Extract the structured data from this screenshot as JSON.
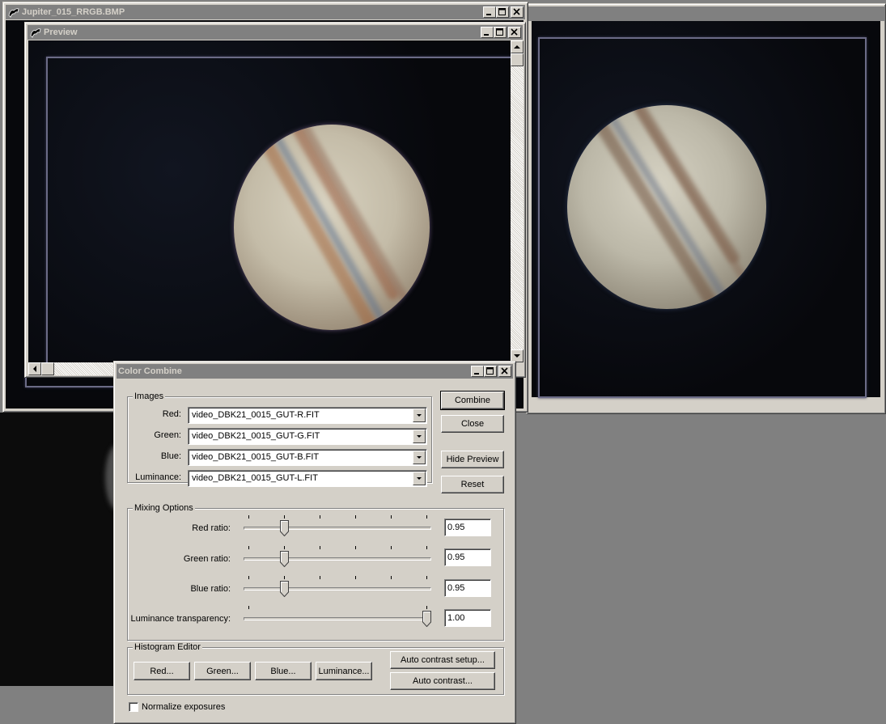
{
  "main_window": {
    "title": "Jupiter_015_RRGB.BMP"
  },
  "preview_window": {
    "title": "Preview"
  },
  "dialog": {
    "title": "Color Combine",
    "images_group": {
      "title": "Images",
      "rows": [
        {
          "label": "Red:",
          "value": "video_DBK21_0015_GUT-R.FIT"
        },
        {
          "label": "Green:",
          "value": "video_DBK21_0015_GUT-G.FIT"
        },
        {
          "label": "Blue:",
          "value": "video_DBK21_0015_GUT-B.FIT"
        },
        {
          "label": "Luminance:",
          "value": "video_DBK21_0015_GUT-L.FIT"
        }
      ]
    },
    "buttons": {
      "combine": "Combine",
      "close": "Close",
      "hide_preview": "Hide Preview",
      "reset": "Reset"
    },
    "mixing_group": {
      "title": "Mixing Options",
      "sliders": [
        {
          "label": "Red ratio:",
          "value": "0.95",
          "position": 0.2
        },
        {
          "label": "Green ratio:",
          "value": "0.95",
          "position": 0.2
        },
        {
          "label": "Blue ratio:",
          "value": "0.95",
          "position": 0.2
        },
        {
          "label": "Luminance transparency:",
          "value": "1.00",
          "position": 1.0
        }
      ]
    },
    "histogram_group": {
      "title": "Histogram Editor",
      "buttons": {
        "red": "Red...",
        "green": "Green...",
        "blue": "Blue...",
        "luminance": "Luminance...",
        "auto_contrast_setup": "Auto contrast setup...",
        "auto_contrast": "Auto contrast..."
      }
    },
    "normalize": {
      "label": "Normalize exposures",
      "checked": false
    }
  },
  "colors": {
    "face": "#d4d0c8",
    "inactive_title": "#808080",
    "inactive_title_text": "#d4d0c8",
    "desktop": "#808080"
  },
  "icons": {
    "app": "app-logo-icon",
    "minimize": "minimize-icon",
    "maximize": "maximize-icon",
    "close": "close-icon"
  }
}
